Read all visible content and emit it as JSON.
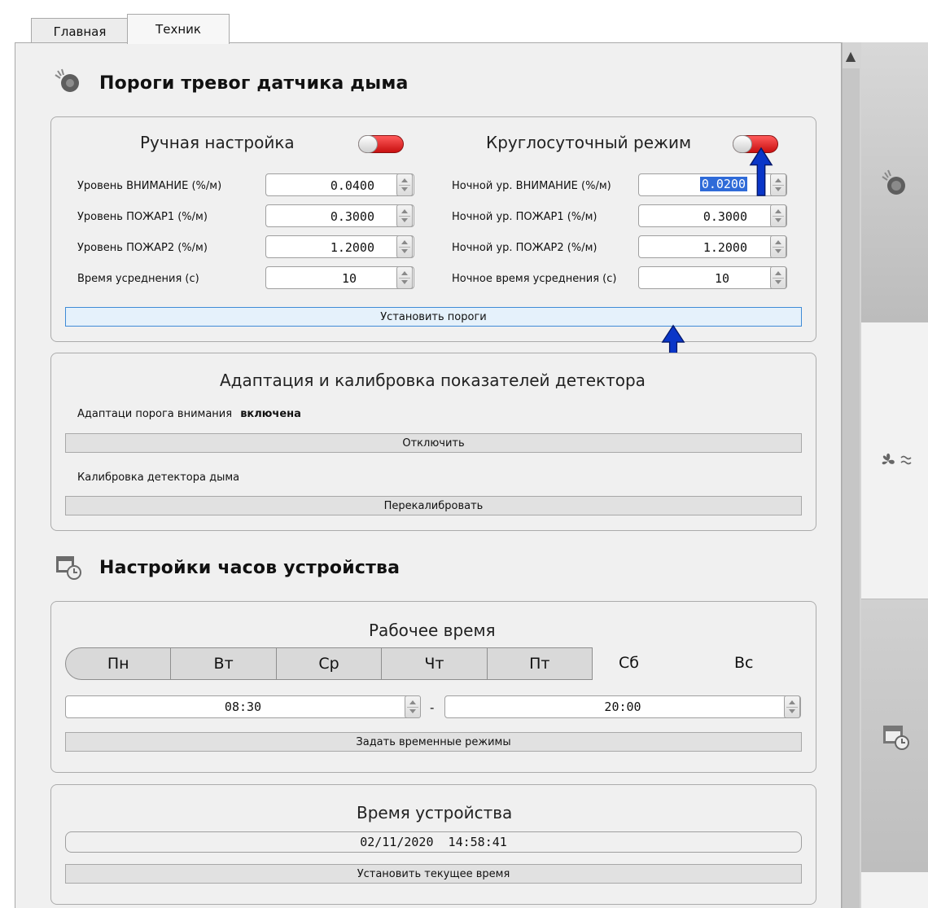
{
  "tabs": [
    {
      "label": "Главная"
    },
    {
      "label": "Техник"
    }
  ],
  "smoke": {
    "title": "Пороги тревог датчика дыма",
    "manual": {
      "title": "Ручная настройка",
      "toggle_on": true,
      "fields": [
        {
          "label": "Уровень ВНИМАНИЕ  (%/м)",
          "value": "0.0400"
        },
        {
          "label": "Уровень ПОЖАР1 (%/м)",
          "value": "0.3000"
        },
        {
          "label": "Уровень ПОЖАР2 (%/м)",
          "value": "1.2000"
        },
        {
          "label": "Время усреднения (с)",
          "value": "10"
        }
      ]
    },
    "night": {
      "title": "Круглосуточный режим",
      "toggle_on": true,
      "fields": [
        {
          "label": "Ночной ур. ВНИМАНИЕ (%/м)",
          "value": "0.0200"
        },
        {
          "label": "Ночной ур.  ПОЖАР1 (%/м)",
          "value": "0.3000"
        },
        {
          "label": "Ночной ур.  ПОЖАР2 (%/м)",
          "value": "1.2000"
        },
        {
          "label": "Ночное время усреднения (с)",
          "value": "10"
        }
      ]
    },
    "set_button": "Установить пороги"
  },
  "adapt": {
    "title": "Адаптация и калибровка показателей детектора",
    "status_label": "Адаптаци порога внимания",
    "status_value": "включена",
    "disable_button": "Отключить",
    "calib_label": "Калибровка детектора дыма",
    "recalibrate_button": "Перекалибровать"
  },
  "clock": {
    "title": "Настройки часов устройства",
    "work": {
      "title": "Рабочее время",
      "days": [
        "Пн",
        "Вт",
        "Ср",
        "Чт",
        "Пт",
        "Сб",
        "Вс"
      ],
      "days_selected": 5,
      "start": "08:30",
      "separator": "-",
      "end": "20:00",
      "button": "Задать временные режимы"
    },
    "device": {
      "title": "Время устройства",
      "datetime": "02/11/2020  14:58:41",
      "button": "Установить текущее время"
    }
  },
  "sidenav": [
    "smoke-detector-icon",
    "fan-airflow-icon",
    "calendar-clock-icon"
  ],
  "colors": {
    "accent_blue": "#0a36c8",
    "toggle_red": "#d91515",
    "selection": "#2f6bd8"
  }
}
